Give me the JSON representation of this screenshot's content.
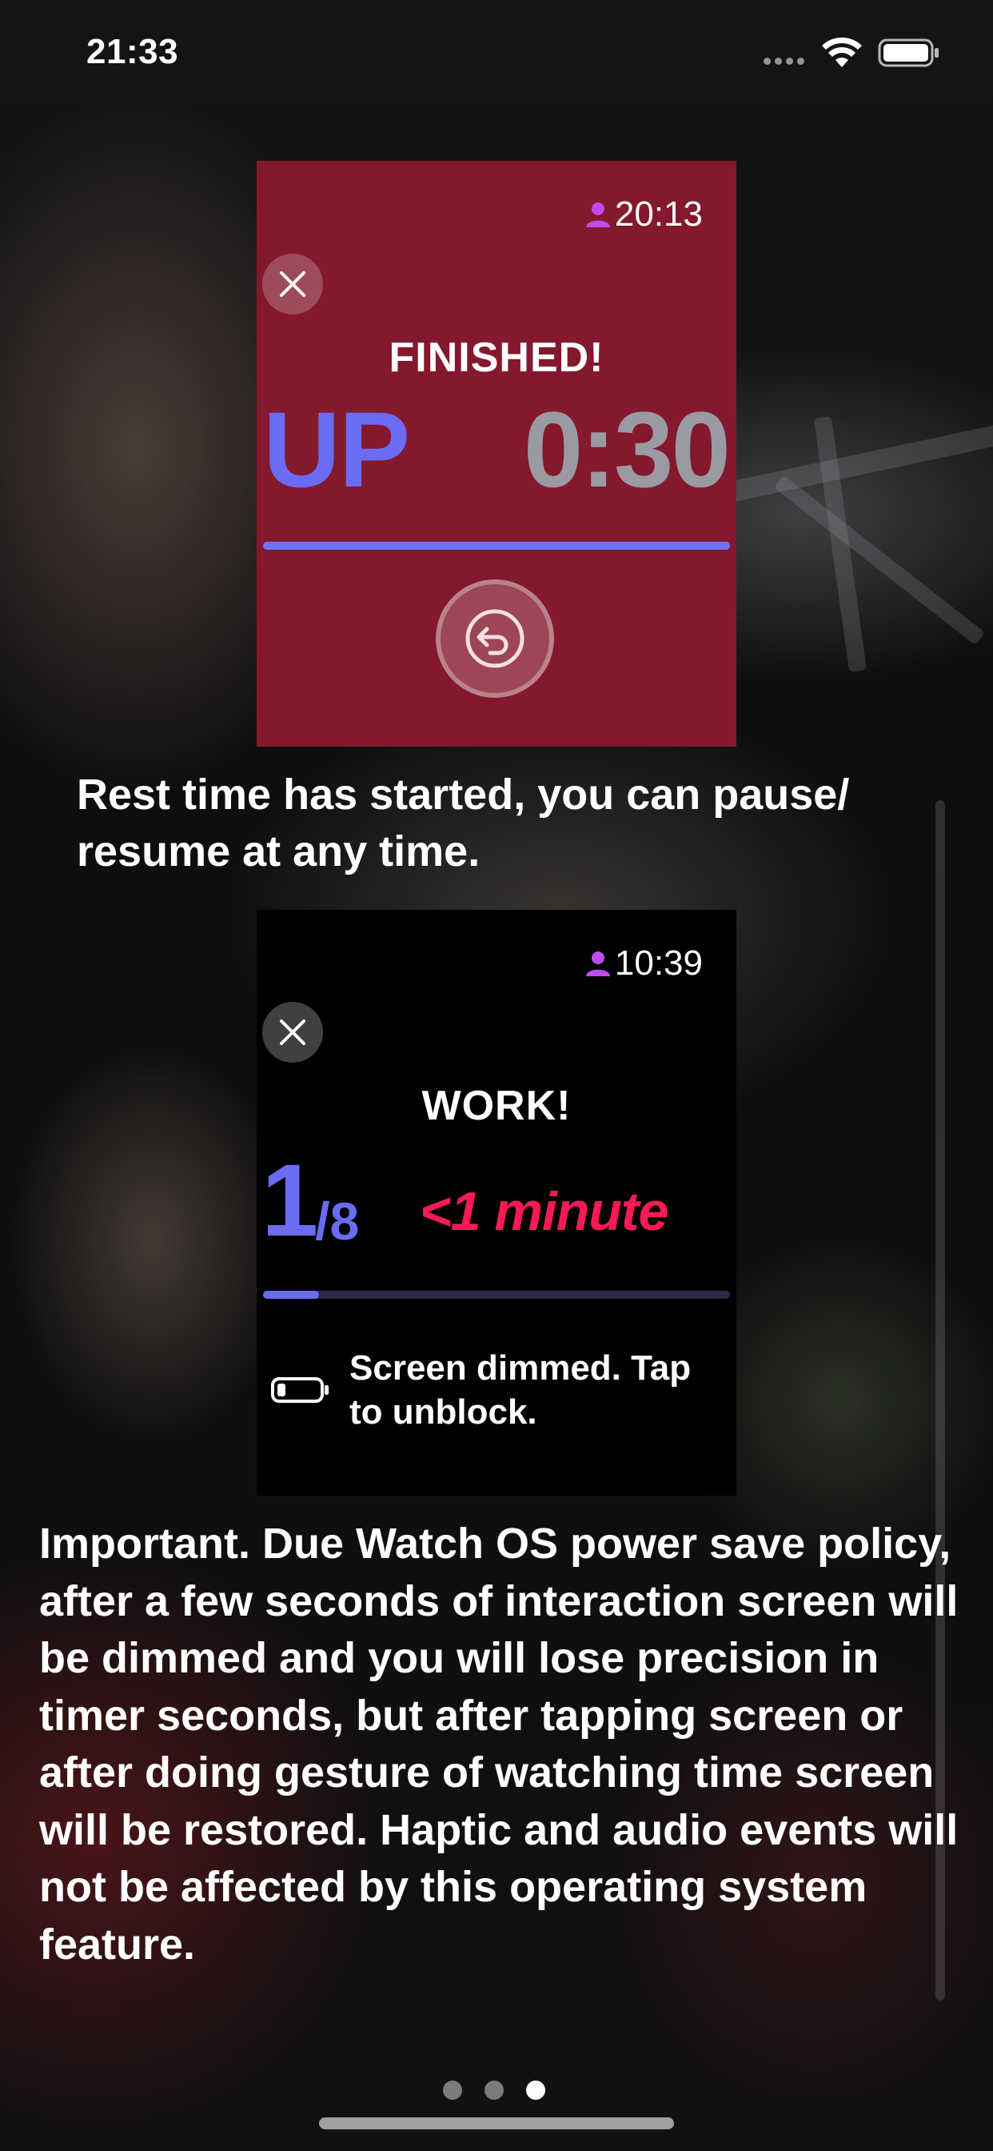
{
  "status_bar": {
    "time": "21:33",
    "wifi_icon": "wifi-icon",
    "battery_icon": "battery-icon",
    "signal_icon": "signal-dots-icon"
  },
  "watch_finished": {
    "clock": "20:13",
    "user_icon": "person-icon",
    "close_icon": "close-icon",
    "title": "FINISHED!",
    "phase": "UP",
    "countdown": "0:30",
    "progress": 1.0,
    "restart_icon": "undo-arrow-icon",
    "background_color": "#84182c",
    "accent_color": "#6a6cf3"
  },
  "caption_rest": "Rest time has started, you can pause/ resume at any time.",
  "watch_work": {
    "clock": "10:39",
    "user_icon": "person-icon",
    "close_icon": "close-icon",
    "title": "WORK!",
    "round_current": "1",
    "round_total": "/8",
    "time_remaining": "<1 minute",
    "progress": 0.12,
    "dim_icon": "low-battery-icon",
    "dim_message": "Screen dimmed. Tap to unblock.",
    "accent_color": "#6a6cf3",
    "warning_color": "#ff1a56"
  },
  "caption_important": "Important. Due Watch OS power save policy, after a few seconds of interaction screen will be dimmed and you will lose precision in timer seconds, but after tapping screen or after doing gesture of watching time screen will be restored. Haptic and audio events will not be affected by this operating system feature.",
  "pagination": {
    "total": 3,
    "active_index": 2
  }
}
